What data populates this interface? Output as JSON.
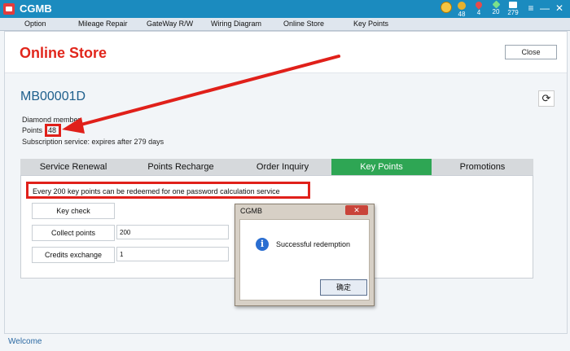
{
  "window": {
    "title": "CGMB",
    "status": [
      {
        "icon": "medal-icon",
        "value": ""
      },
      {
        "icon": "gold-coin-icon",
        "value": "48"
      },
      {
        "icon": "heart-icon",
        "value": "4"
      },
      {
        "icon": "diamond-icon",
        "value": "20"
      },
      {
        "icon": "calendar-icon",
        "value": "279"
      }
    ],
    "controls": {
      "menu": "≡",
      "minimize": "—",
      "close": "✕"
    }
  },
  "menu": [
    "Option",
    "Mileage Repair",
    "GateWay R/W",
    "Wiring Diagram",
    "Online Store",
    "Key Points"
  ],
  "page": {
    "title": "Online Store",
    "close_label": "Close",
    "member_id": "MB00001D",
    "membership": "Diamond member",
    "points_label": "Points",
    "points_value": "48",
    "subscription": "Subscription service: expires after 279 days",
    "refresh_icon": "refresh-icon"
  },
  "tabs": [
    "Service Renewal",
    "Points Recharge",
    "Order Inquiry",
    "Key Points",
    "Promotions"
  ],
  "active_tab": "Key Points",
  "key_points": {
    "notice": "Every 200 key points can be redeemed for one password calculation service",
    "key_check_label": "Key check",
    "collect_label": "Collect points",
    "collect_value": "200",
    "exchange_label": "Credits exchange",
    "exchange_value": "1"
  },
  "dialog": {
    "title": "CGMB",
    "close_label": "✕",
    "icon": "info-icon",
    "message": "Successful redemption",
    "ok_label": "确定"
  },
  "status_bar": {
    "text": "Welcome"
  },
  "colors": {
    "titlebar": "#1b8bbf",
    "page_title": "#e1261c",
    "active_tab": "#2ea654",
    "highlight": "#e0201a"
  }
}
